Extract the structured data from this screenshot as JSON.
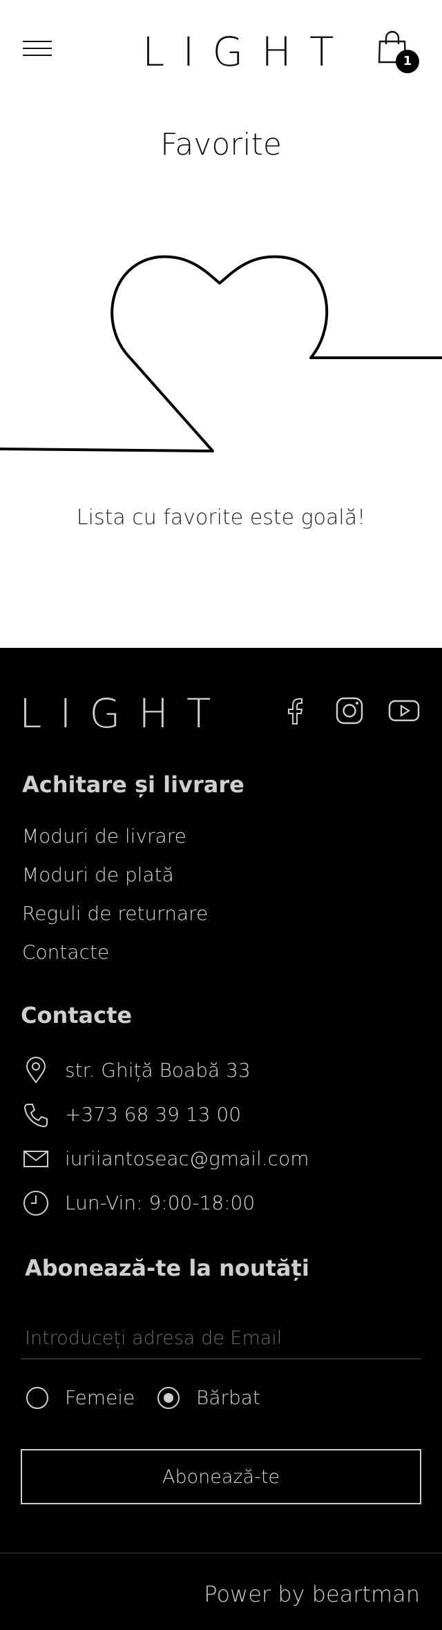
{
  "header": {
    "logo": "LIGHT",
    "cart_count": "1"
  },
  "main": {
    "title": "Favorite",
    "empty_message": "Lista cu favorite este goală!"
  },
  "footer": {
    "logo": "LIGHT",
    "social": [
      "facebook-icon",
      "instagram-icon",
      "youtube-icon"
    ],
    "section_delivery": {
      "heading": "Achitare și livrare",
      "links": [
        "Moduri de livrare",
        "Moduri de plată",
        "Reguli de returnare",
        "Contacte"
      ]
    },
    "section_contacts": {
      "heading": "Contacte",
      "address": "str. Ghiță Boabă 33",
      "phone": "+373 68 39 13 00",
      "email": "iuriiantoseac@gmail.com",
      "hours": "Lun-Vin: 9:00-18:00"
    },
    "newsletter": {
      "heading": "Abonează-te la noutăți",
      "email_placeholder": "Introduceți adresa de Email",
      "email_value": "",
      "gender_options": [
        "Femeie",
        "Bărbat"
      ],
      "selected_gender": "Bărbat",
      "subscribe_label": "Abonează-te"
    },
    "powered_by": "Power by beartman"
  },
  "colors": {
    "footer_bg": "#000000",
    "footer_text": "#d6d6d6",
    "badge_bg": "#000000"
  }
}
